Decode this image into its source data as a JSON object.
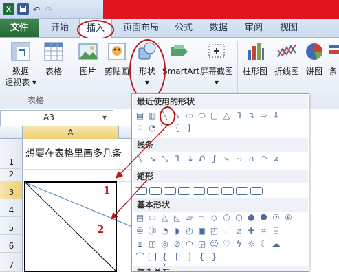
{
  "quick_access": {
    "excel": "X",
    "undo": "↶",
    "redo": "↷"
  },
  "tabs": [
    "文件",
    "开始",
    "插入",
    "页面布局",
    "公式",
    "数据",
    "审阅",
    "视图"
  ],
  "ribbon": {
    "pivot": "数据\n透视表",
    "pivot_line1": "数据",
    "pivot_line2": "透视表 ▾",
    "table": "表格",
    "picture": "图片",
    "clipart": "剪贴画",
    "shapes": "形状",
    "smartart": "SmartArt",
    "screenshot": "屏幕截图",
    "column_chart": "柱形图",
    "line_chart": "折线图",
    "pie_chart": "饼图",
    "bar_chart": "条",
    "group_tables": "表格"
  },
  "name_box": "A3",
  "column_header": "A",
  "rows": [
    "1",
    "2",
    "3",
    "4",
    "5",
    "6",
    "7"
  ],
  "cell_a1": "想要在表格里画多几条",
  "dropdown": {
    "recent": "最近使用的形状",
    "lines": "线条",
    "rectangles": "矩形",
    "basic": "基本形状",
    "arrows": "箭头总汇"
  },
  "annotations": {
    "one": "1",
    "two": "2"
  },
  "colors": {
    "accent_red": "#b8171c",
    "file_tab": "#26683a",
    "title_red": "#e21420"
  }
}
